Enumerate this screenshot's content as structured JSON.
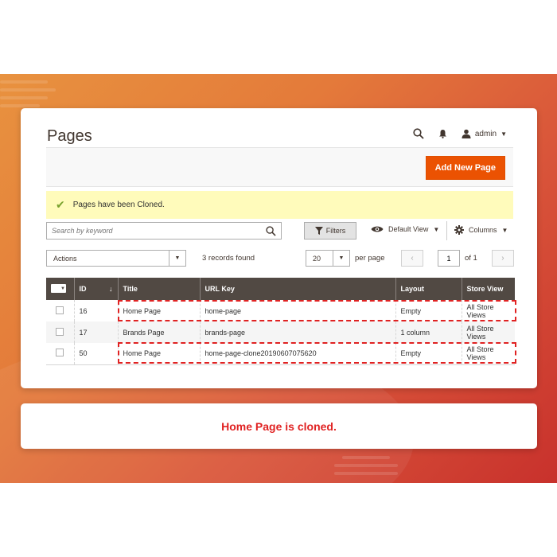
{
  "page_title": "Pages",
  "header": {
    "admin_label": "admin"
  },
  "actions_bar": {
    "add_new_label": "Add New Page"
  },
  "message": {
    "text": "Pages have been Cloned."
  },
  "toolbar": {
    "search_placeholder": "Search by keyword",
    "filters_label": "Filters",
    "view_label": "Default View",
    "columns_label": "Columns",
    "actions_label": "Actions",
    "records_found": "3 records found",
    "per_page_value": "20",
    "per_page_label": "per page",
    "current_page": "1",
    "page_total": "of 1"
  },
  "table": {
    "columns": [
      "ID",
      "Title",
      "URL Key",
      "Layout",
      "Store View"
    ],
    "rows": [
      {
        "id": "16",
        "title": "Home Page",
        "url_key": "home-page",
        "layout": "Empty",
        "store_view": "All Store Views"
      },
      {
        "id": "17",
        "title": "Brands Page",
        "url_key": "brands-page",
        "layout": "1 column",
        "store_view": "All Store Views"
      },
      {
        "id": "50",
        "title": "Home Page",
        "url_key": "home-page-clone20190607075620",
        "layout": "Empty",
        "store_view": "All Store Views"
      }
    ]
  },
  "caption": "Home Page is cloned.",
  "colors": {
    "accent": "#eb5202",
    "header_bg": "#514943",
    "highlight": "#e02222",
    "success": "#79a22e"
  }
}
